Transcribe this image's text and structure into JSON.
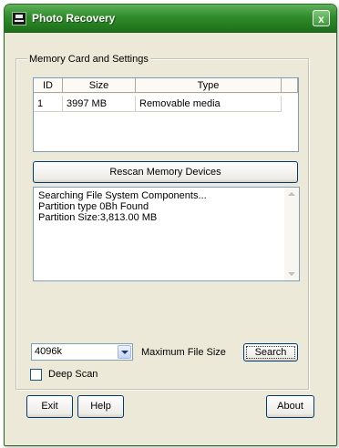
{
  "window": {
    "title": "Photo Recovery",
    "close_glyph": "x"
  },
  "group": {
    "label": "Memory Card and Settings"
  },
  "devices": {
    "columns": [
      "ID",
      "Size",
      "Type"
    ],
    "rows": [
      {
        "id": "1",
        "size": "3997 MB",
        "type": "Removable media"
      }
    ]
  },
  "buttons": {
    "rescan": "Rescan Memory Devices",
    "search": "Search",
    "exit": "Exit",
    "help": "Help",
    "about": "About"
  },
  "log": {
    "lines": [
      "Searching File System Components...",
      "Partition type 0Bh Found",
      "Partition Size:3,813.00 MB"
    ]
  },
  "max_file_size": {
    "value": "4096k",
    "label": "Maximum File Size"
  },
  "deep_scan": {
    "label": "Deep Scan",
    "checked": false
  },
  "colors": {
    "titlebar": "#2f8c2a",
    "dialog_bg": "#ece9d8",
    "field_border": "#7f9db9"
  }
}
